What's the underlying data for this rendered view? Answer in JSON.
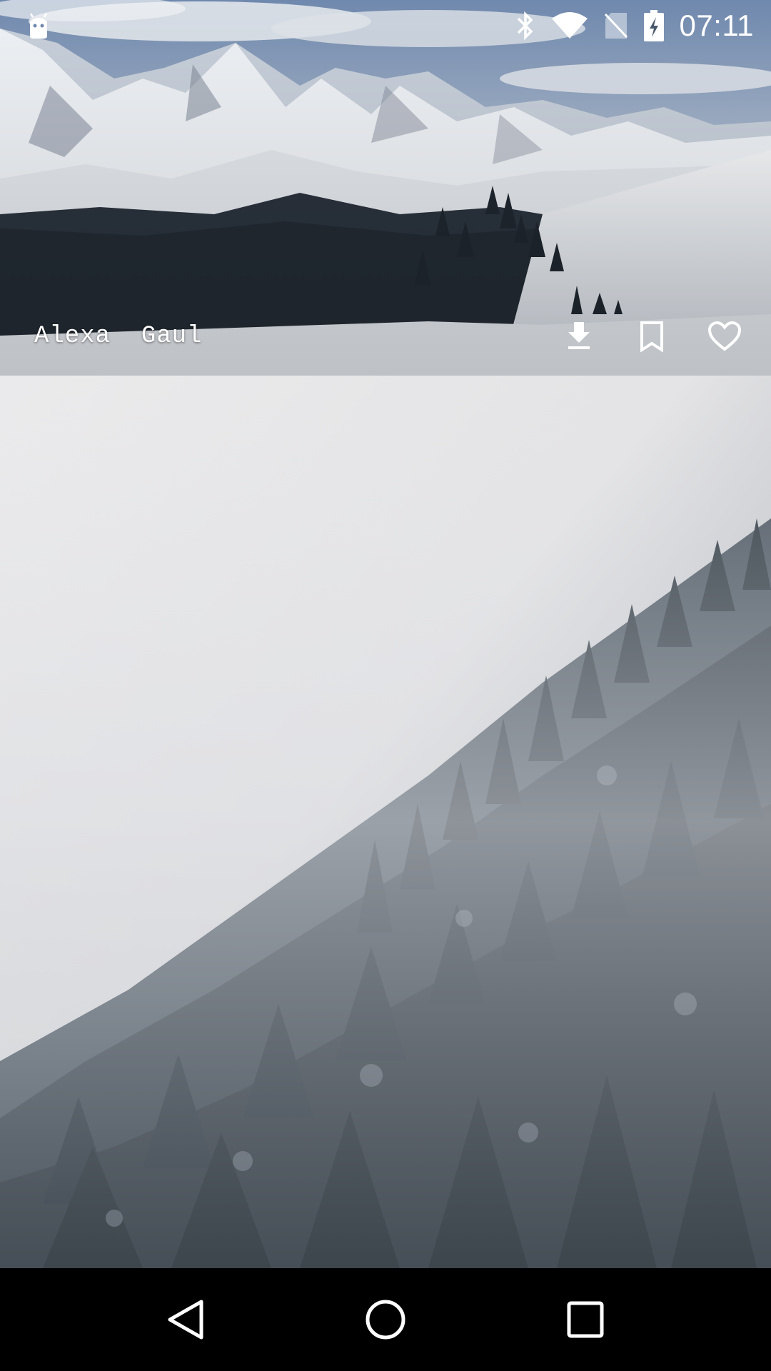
{
  "status_bar": {
    "time": "07:11",
    "icons": [
      "android-debug-icon",
      "bluetooth-icon",
      "wifi-icon",
      "no-sim-icon",
      "battery-charging-icon"
    ]
  },
  "feed": {
    "photos": [
      {
        "author": "Alexa  Gaul",
        "scene": "snowy mountain range",
        "actions": [
          "download-icon",
          "bookmark-icon",
          "heart-icon"
        ]
      },
      {
        "author": "",
        "scene": "misty pine forest"
      }
    ]
  },
  "nav_bar": {
    "buttons": [
      "back-icon",
      "home-icon",
      "recents-icon"
    ]
  },
  "colors": {
    "status_icons": "#ffffff",
    "nav_background": "#000000",
    "overlay_text": "#ffffff"
  }
}
